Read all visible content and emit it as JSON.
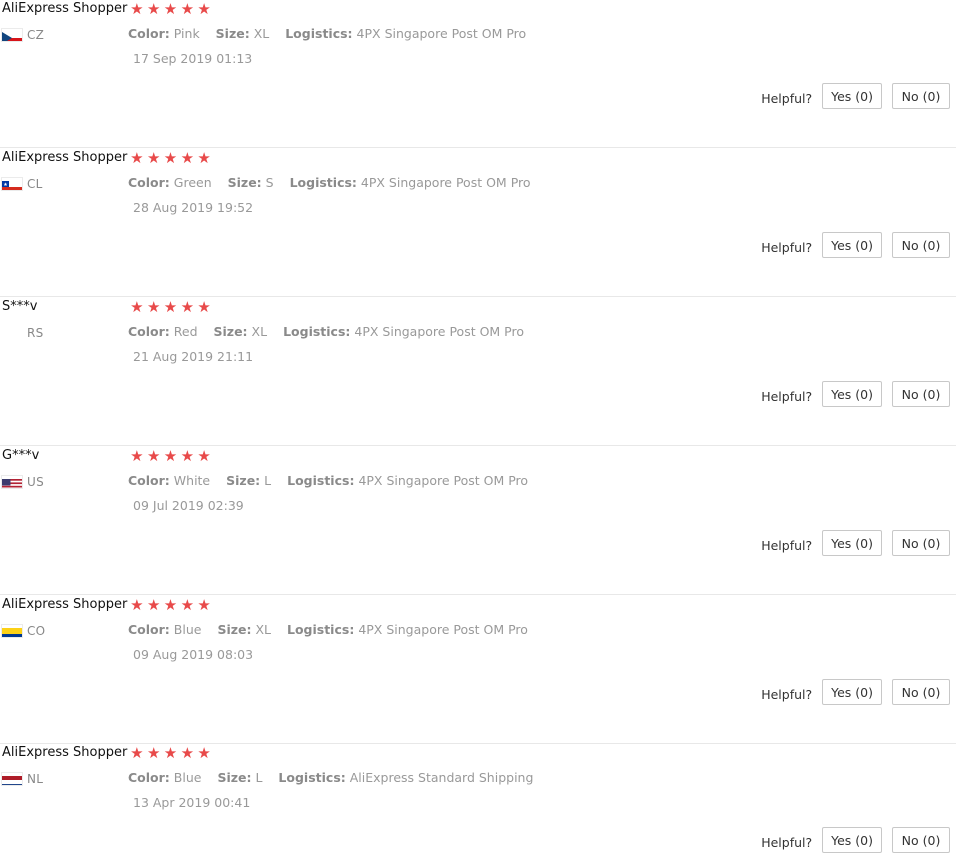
{
  "helpful_label": "Helpful?",
  "star_glyph": "★",
  "star_color": "#e84a4a",
  "labels": {
    "color": "Color:",
    "size": "Size:",
    "logistics": "Logistics:"
  },
  "reviews": [
    {
      "buyer": "AliExpress Shopper",
      "country": "CZ",
      "flag": "czech-flag",
      "rating": 5,
      "color": "Pink",
      "size": "XL",
      "logistics": "4PX Singapore Post OM Pro",
      "date": "17 Sep 2019 01:13",
      "yes": "Yes (0)",
      "no": "No (0)"
    },
    {
      "buyer": "AliExpress Shopper",
      "country": "CL",
      "flag": "chile-flag",
      "rating": 5,
      "color": "Green",
      "size": "S",
      "logistics": "4PX Singapore Post OM Pro",
      "date": "28 Aug 2019 19:52",
      "yes": "Yes (0)",
      "no": "No (0)"
    },
    {
      "buyer": "S***v",
      "country": "RS",
      "flag": "",
      "rating": 5,
      "color": "Red",
      "size": "XL",
      "logistics": "4PX Singapore Post OM Pro",
      "date": "21 Aug 2019 21:11",
      "yes": "Yes (0)",
      "no": "No (0)"
    },
    {
      "buyer": "G***v",
      "country": "US",
      "flag": "us-flag",
      "rating": 5,
      "color": "White",
      "size": "L",
      "logistics": "4PX Singapore Post OM Pro",
      "date": "09 Jul 2019 02:39",
      "yes": "Yes (0)",
      "no": "No (0)"
    },
    {
      "buyer": "AliExpress Shopper",
      "country": "CO",
      "flag": "colombia-flag",
      "rating": 5,
      "color": "Blue",
      "size": "XL",
      "logistics": "4PX Singapore Post OM Pro",
      "date": "09 Aug 2019 08:03",
      "yes": "Yes (0)",
      "no": "No (0)"
    },
    {
      "buyer": "AliExpress Shopper",
      "country": "NL",
      "flag": "netherlands-flag",
      "rating": 5,
      "color": "Blue",
      "size": "L",
      "logistics": "AliExpress Standard Shipping",
      "date": "13 Apr 2019 00:41",
      "yes": "Yes (0)",
      "no": "No (0)"
    }
  ]
}
